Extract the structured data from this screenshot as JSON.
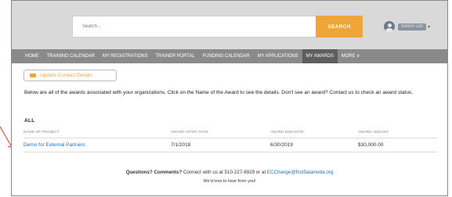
{
  "header": {
    "search_placeholder": "Search...",
    "search_button": "SEARCH",
    "user_name": "SARAH LEE"
  },
  "nav": {
    "items": [
      {
        "label": "HOME"
      },
      {
        "label": "TRAINING CALENDAR"
      },
      {
        "label": "MY REGISTRATIONS"
      },
      {
        "label": "TRAINER PORTAL"
      },
      {
        "label": "FUNDING CALENDAR"
      },
      {
        "label": "MY APPLICATIONS"
      },
      {
        "label": "MY AWARDS"
      },
      {
        "label": "MORE ∨"
      }
    ],
    "active_index": 6
  },
  "update_button": "Update Contact Details",
  "intro": "Below are all of the awards associated with your organizations. Click on the Name of the Award to see the details.  Don't see an award? Contact us to check an award status.",
  "section_title": "ALL",
  "table": {
    "headers": [
      "NAME OF PROJECT",
      "AWARD START DATE",
      "AWARD END DATE",
      "AWARD AMOUNT"
    ],
    "rows": [
      {
        "project": "Demo for External Partners",
        "start": "7/1/2018",
        "end": "6/30/2019",
        "amount": "$30,000.00"
      }
    ]
  },
  "footer": {
    "question_bold": "Questions? Comments?",
    "question_text": " Connect with us at 510-227-6929 or at ",
    "email": "ECChange@first5alameda.org",
    "love": "We'd love to hear from you!"
  },
  "colors": {
    "accent": "#f0a53a",
    "nav_bg": "#8a8a8a",
    "nav_active": "#5e5e5e",
    "link": "#1f6fbf",
    "arrow": "#e03a2e"
  }
}
